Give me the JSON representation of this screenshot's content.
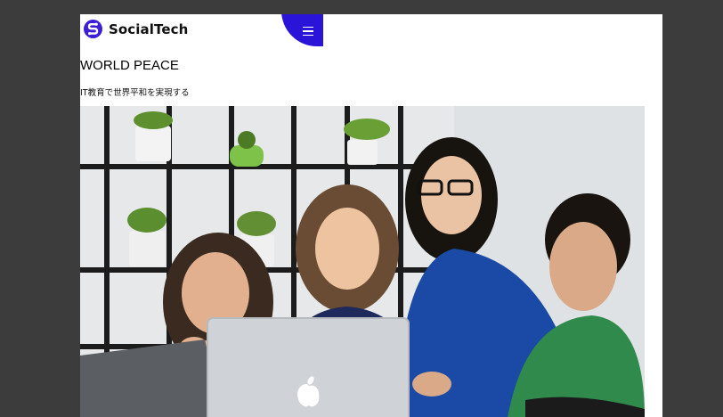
{
  "header": {
    "brand": "SocialTech",
    "logo_icon": "logo-s-icon",
    "menu_icon": "hamburger-menu-icon",
    "accent_color": "#2a14d8"
  },
  "main": {
    "title": "WORLD PEACE",
    "subtitle": "IT教育で世界平和を実現する"
  },
  "hero_image": {
    "icon": "team-photo",
    "description_icon": "laptop-apple-logo-icon"
  }
}
